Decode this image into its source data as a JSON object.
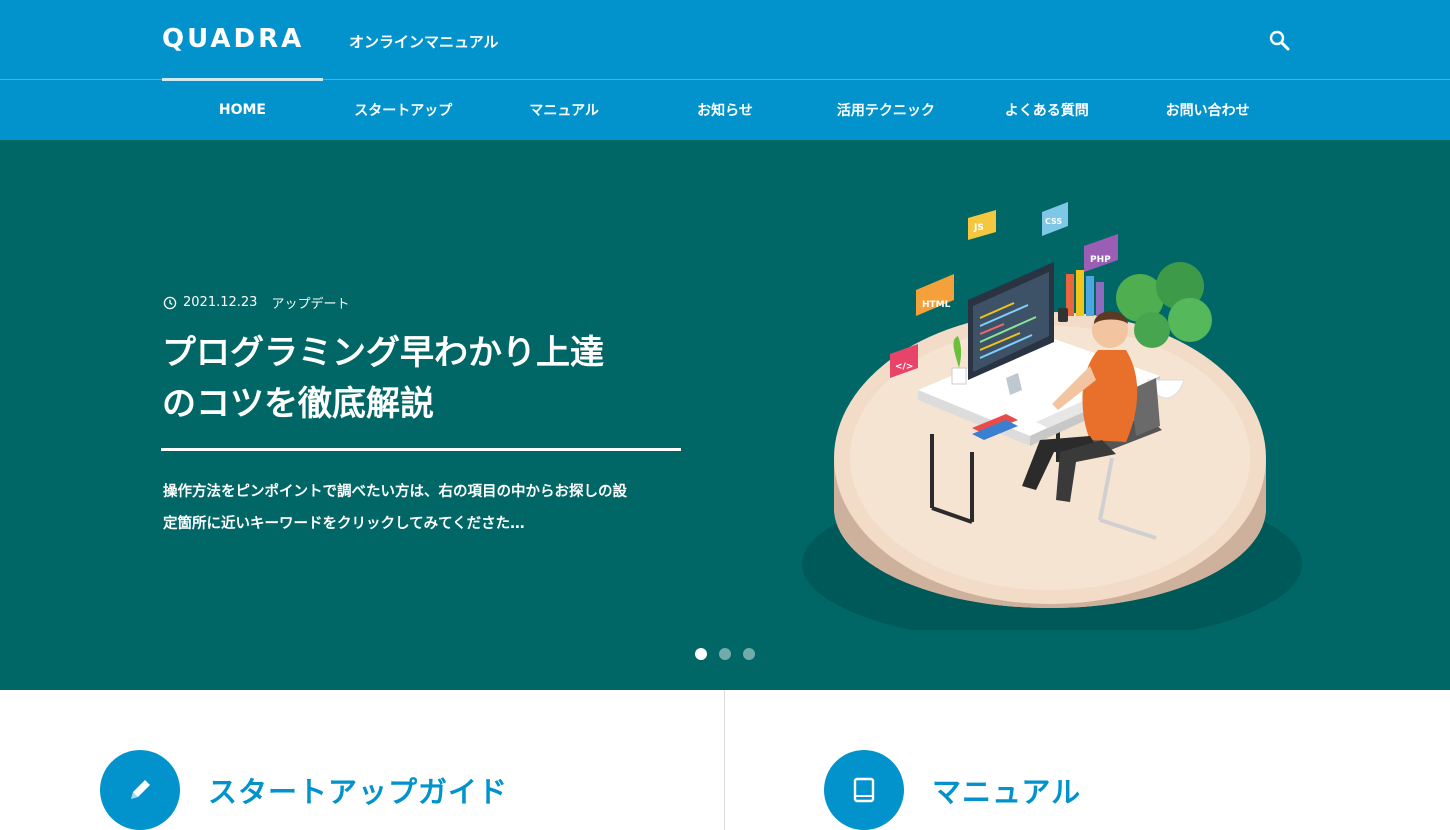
{
  "header": {
    "logo": "QUADRA",
    "site_description": "オンラインマニュアル",
    "search_icon": "search-icon"
  },
  "nav": {
    "items": [
      {
        "label": "HOME",
        "active": true
      },
      {
        "label": "スタートアップ"
      },
      {
        "label": "マニュアル"
      },
      {
        "label": "お知らせ"
      },
      {
        "label": "活用テクニック"
      },
      {
        "label": "よくある質問"
      },
      {
        "label": "お問い合わせ"
      }
    ]
  },
  "hero": {
    "date": "2021.12.23",
    "category": "アップデート",
    "title_line1": "プログラミング早わかり上達",
    "title_line2": "のコツを徹底解説",
    "description_line1": "操作方法をピンポイントで調べたい方は、右の項目の中からお探しの設",
    "description_line2": "定箇所に近いキーワードをクリックしてみてくださた…",
    "tags": [
      "JS",
      "CSS",
      "PHP",
      "HTML",
      "</>"
    ],
    "slides": 3,
    "active_slide": 1,
    "colors": {
      "background": "#006766"
    }
  },
  "cards": [
    {
      "label": "スタートアップガイド",
      "icon": "pencil-icon"
    },
    {
      "label": "マニュアル",
      "icon": "book-icon"
    }
  ],
  "colors": {
    "brand": "#0293cc"
  }
}
